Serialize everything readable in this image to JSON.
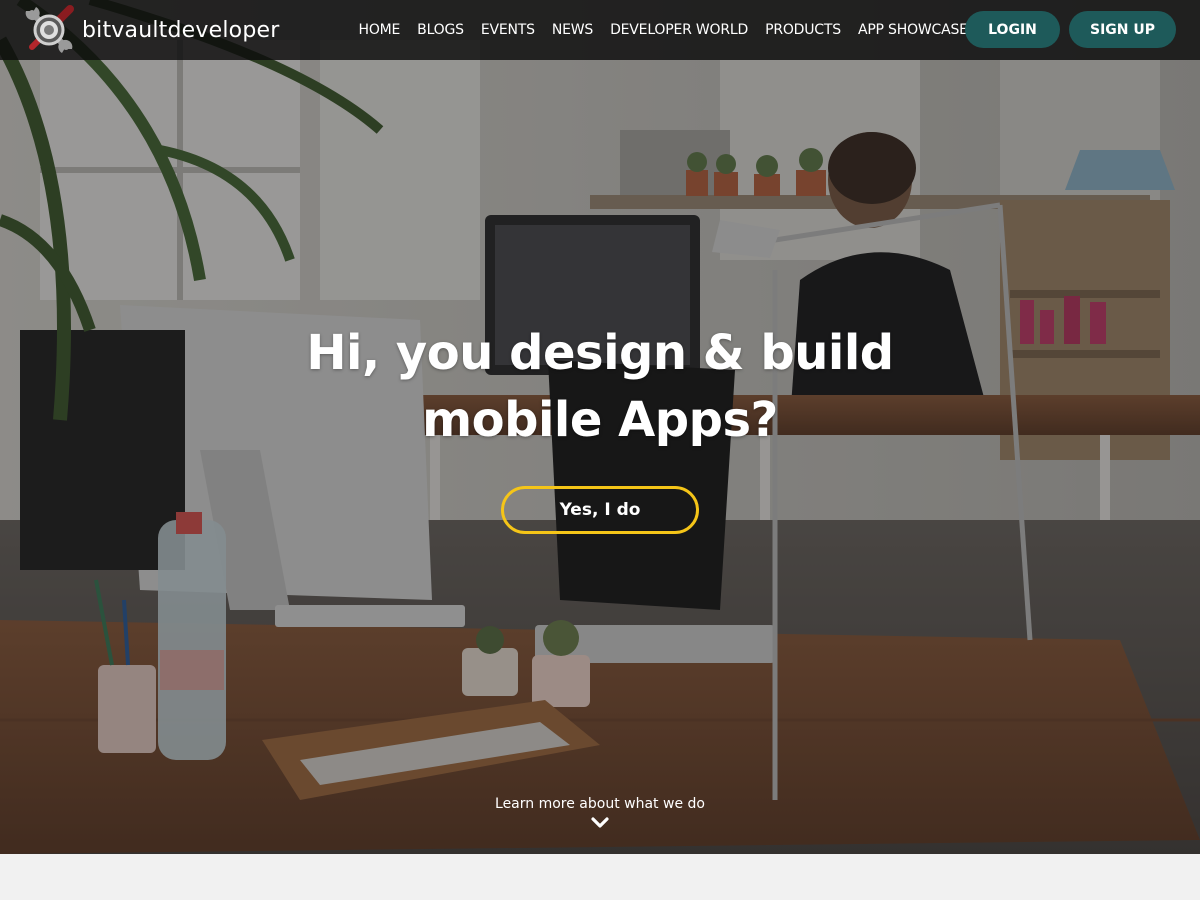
{
  "brand": {
    "name": "bitvaultdeveloper",
    "logo_icon": "wrench-screwdriver-gear-icon"
  },
  "nav": {
    "links": [
      {
        "label": "HOME"
      },
      {
        "label": "BLOGS"
      },
      {
        "label": "EVENTS"
      },
      {
        "label": "NEWS"
      },
      {
        "label": "DEVELOPER WORLD"
      },
      {
        "label": "PRODUCTS"
      },
      {
        "label": "APP SHOWCASE"
      }
    ],
    "login_label": "LOGIN",
    "signup_label": "SIGN UP"
  },
  "hero": {
    "title_line1": "Hi, you design & build",
    "title_line2": "mobile Apps?",
    "cta_label": "Yes, I do",
    "learn_more": "Learn more about what we do",
    "background": "office-workspace-photo"
  },
  "colors": {
    "navbar_bg": "#0c0c0c",
    "nav_button_bg": "#1e5a5a",
    "cta_border": "#f5c518",
    "page_bg": "#f1f1f1"
  }
}
